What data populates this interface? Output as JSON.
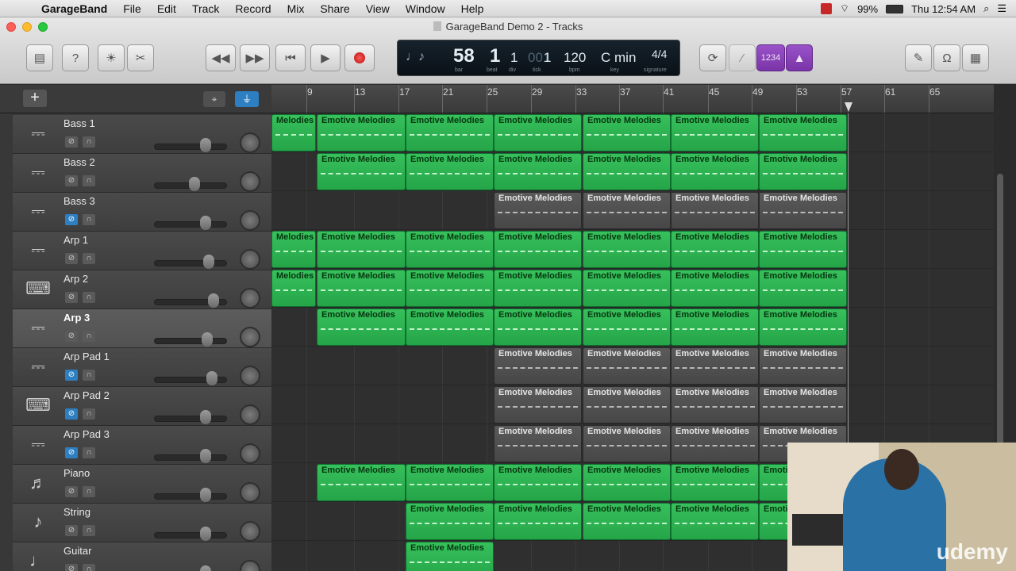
{
  "menubar": {
    "app": "GarageBand",
    "items": [
      "File",
      "Edit",
      "Track",
      "Record",
      "Mix",
      "Share",
      "View",
      "Window",
      "Help"
    ],
    "battery": "99%",
    "clock": "Thu 12:54 AM"
  },
  "window": {
    "title": "GarageBand Demo 2 - Tracks"
  },
  "lcd": {
    "bar": "58",
    "beat": "1",
    "div": "1",
    "tick": "1",
    "tick_dim": "001",
    "bpm": "120",
    "key": "C min",
    "signature": "4/4",
    "cap_bar": "bar",
    "cap_beat": "beat",
    "cap_div": "div",
    "cap_tick": "tick",
    "cap_bpm": "bpm",
    "cap_key": "key",
    "cap_sig": "signature"
  },
  "count_in": "1234",
  "ruler": {
    "ticks": [
      "9",
      "13",
      "17",
      "21",
      "25",
      "29",
      "33",
      "37",
      "41",
      "45",
      "49",
      "53",
      "57",
      "61",
      "65"
    ]
  },
  "tracks": [
    {
      "name": "Bass 1",
      "icon": "synth-icon",
      "mute_on": false
    },
    {
      "name": "Bass 2",
      "icon": "synth-icon",
      "mute_on": false
    },
    {
      "name": "Bass 3",
      "icon": "synth-icon",
      "mute_on": true
    },
    {
      "name": "Arp 1",
      "icon": "synth-icon",
      "mute_on": false
    },
    {
      "name": "Arp 2",
      "icon": "keyboard-stand-icon",
      "mute_on": false
    },
    {
      "name": "Arp 3",
      "icon": "synth-icon",
      "mute_on": false,
      "selected": true
    },
    {
      "name": "Arp Pad 1",
      "icon": "synth-icon",
      "mute_on": true
    },
    {
      "name": "Arp Pad 2",
      "icon": "keyboard-stand-icon",
      "mute_on": true
    },
    {
      "name": "Arp Pad 3",
      "icon": "synth-icon",
      "mute_on": true
    },
    {
      "name": "Piano",
      "icon": "grand-piano-icon",
      "mute_on": false
    },
    {
      "name": "String",
      "icon": "violin-icon",
      "mute_on": false
    },
    {
      "name": "Guitar",
      "icon": "guitar-icon",
      "mute_on": false
    }
  ],
  "region_label": "Emotive Melodies",
  "region_label_cut": "Melodies",
  "region_label_cut2": "Emoti",
  "watermark": "udemy"
}
